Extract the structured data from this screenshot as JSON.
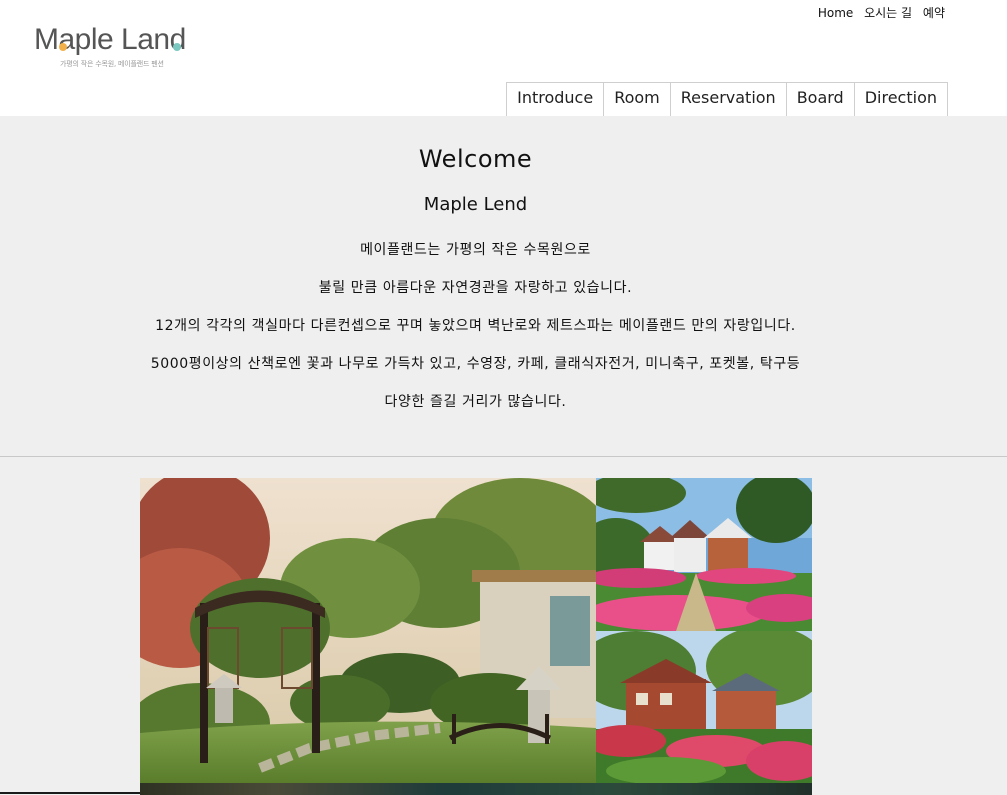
{
  "brand": {
    "name": "Maple Land",
    "tagline": "가평의 작은 수목원, 메이플랜드 펜션",
    "accent_left": "#f2b04a",
    "accent_right": "#7ac8c0"
  },
  "util_links": [
    {
      "label": "Home"
    },
    {
      "label": "오시는 길"
    },
    {
      "label": "예약"
    }
  ],
  "nav": [
    {
      "label": "Introduce"
    },
    {
      "label": "Room"
    },
    {
      "label": "Reservation"
    },
    {
      "label": "Board"
    },
    {
      "label": "Direction"
    }
  ],
  "welcome": {
    "title": "Welcome",
    "subtitle": "Maple Lend",
    "lines": [
      "메이플랜드는 가평의 작은 수목원으로",
      "불릴 만큼 아름다운 자연경관을 자랑하고 있습니다.",
      "12개의 각각의 객실마다 다른컨셉으로 꾸며 놓았으며 벽난로와 제트스파는 메이플랜드 만의 자랑입니다.",
      "5000평이상의 산책로엔 꽃과 나무로 가득차 있고, 수영장, 카페, 클래식자전거, 미니축구, 포켓볼, 탁구등",
      "다양한 즐길 거리가 많습니다."
    ]
  },
  "gallery": {
    "images": [
      {
        "icon": "garden-arbor-photo"
      },
      {
        "icon": "pension-houses-photo"
      },
      {
        "icon": "flower-garden-photo"
      }
    ]
  },
  "colors": {
    "section_bg": "#efefef",
    "nav_border": "#cfcfcf",
    "divider": "#c8c8c8"
  }
}
